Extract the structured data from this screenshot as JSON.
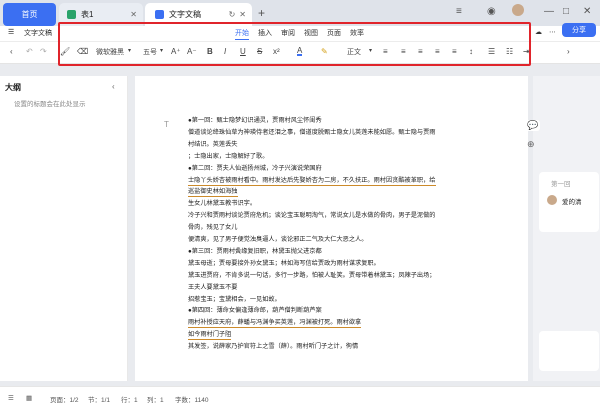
{
  "tabs": {
    "home": "首页",
    "sheet": "表1",
    "doc": "文字文稿",
    "plus": "+"
  },
  "menu": {
    "app_menu": "文字文稿",
    "items": [
      "开始",
      "插入",
      "审阅",
      "视图",
      "页面",
      "效率"
    ],
    "active_index": 0,
    "share": "分享"
  },
  "toolbar": {
    "font": "微软雅黑",
    "size": "五号",
    "style": "正文",
    "grow": "A⁺",
    "shrink": "A⁻",
    "bold": "B",
    "italic": "I",
    "underline": "U",
    "strike": "S"
  },
  "outline": {
    "title": "大纲",
    "hint": "设置的标题会在此处显示"
  },
  "doc": {
    "lines": [
      {
        "text": "●第一回：甄士隐梦幻识通灵，贾雨村风尘怀闺秀",
        "underline": false
      },
      {
        "text": "僧道谈论绛珠仙草为神瑛侍者还泪之事，僧道度脱甄士隐女儿英莲未能如愿。甄士隐与贾雨",
        "underline": false
      },
      {
        "text": "村结识。英莲丢失",
        "underline": false
      },
      {
        "text": "；士隐出家，士隐解好了歌。",
        "underline": false
      },
      {
        "text": "●第二回：贾夫人仙逝扬州城，冷子兴演说荣国府",
        "underline": false
      },
      {
        "text": "士隐丫头娇杏被雨村看中。雨村发达后先娶娇杏为二房，不久扶正。雨村因贪酷被革职，给",
        "underline": true
      },
      {
        "text": "巡盐御史林如海独",
        "underline": true
      },
      {
        "text": "生女儿林黛玉教书识字。",
        "underline": false
      },
      {
        "text": "冷子兴和贾雨村谈论贾府危机；谈论宝玉聪明淘气，常说女儿是水做的骨肉，男子是泥做的",
        "underline": false
      },
      {
        "text": "骨肉，残见了女儿",
        "underline": false
      },
      {
        "text": "便清爽，见了男子便觉浊臭逼人，谈论邪正二气及大仁大恶之人。",
        "underline": false
      },
      {
        "text": "●第三回：贾雨村夤缘复旧职，林黛玉抛父进京都",
        "underline": false
      },
      {
        "text": "黛玉母逝；贾母要接外孙女黛玉；林如海写信给贾政为雨村谋求复职。",
        "underline": false
      },
      {
        "text": "黛玉进贾府，不肯多说一句话，多行一步路，怕被人耻笑。贾母带着林黛玉；凤辣子出场；",
        "underline": false
      },
      {
        "text": "王夫人要黛玉不要",
        "underline": false
      },
      {
        "text": "招惹宝玉；宝黛相会，一见如故。",
        "underline": false
      },
      {
        "text": "●第四回：薄命女偏逢薄命郎，葫芦僧判断葫芦案",
        "underline": false
      },
      {
        "text": "雨村补授应天府，薛蟠与冯渊争买英莲，冯渊被打死。雨村欲拿",
        "underline": true
      },
      {
        "text": "如今雨村门子阻",
        "underline": true
      },
      {
        "text": "其发签，说薛家乃护官符上之雪（薛）。雨村听门子之计，徇情",
        "underline": false
      }
    ]
  },
  "right_panel": {
    "comment_line": "第一回",
    "comment_text": "爱的清"
  },
  "status": {
    "page": "页面：1/2",
    "section": "节：1/1",
    "row": "行：1",
    "col": "列：1",
    "words": "字数：1140"
  },
  "colors": {
    "accent": "#3b6ff2",
    "highlight_frame": "#e0242b",
    "underline": "#cc8a2a"
  }
}
